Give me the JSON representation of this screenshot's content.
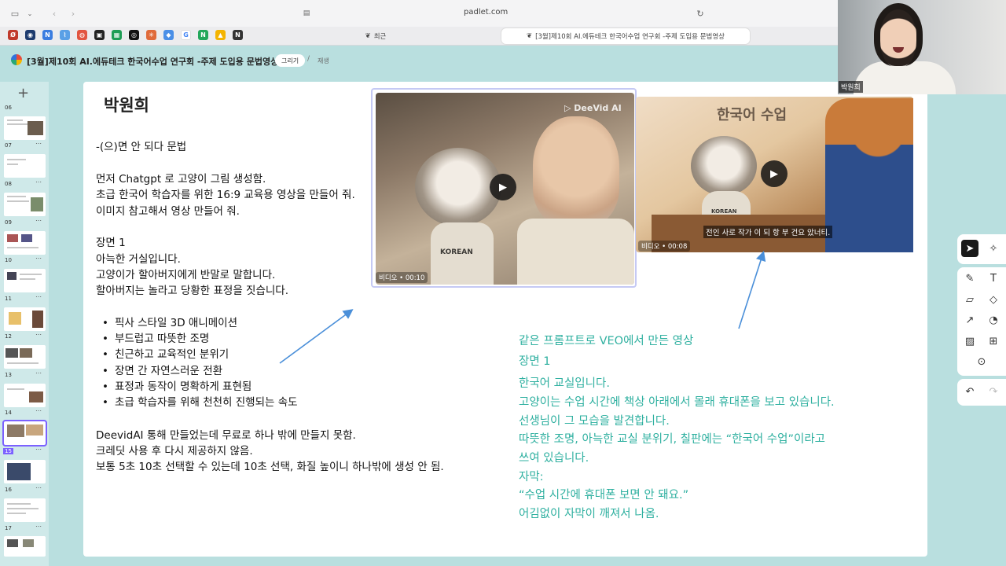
{
  "browser": {
    "url": "padlet.com",
    "tabs": [
      {
        "label": "최근"
      },
      {
        "label": "[3월]제10회 AI.에듀테크 한국어수업 연구회 -주제 도입용 문법영상"
      }
    ]
  },
  "header": {
    "title": "[3월]제10회 AI.에듀테크 한국어수업 연구회 -주제 도입용 문법영상",
    "draw_label": "그리기",
    "play_label": "재생"
  },
  "sidebar": {
    "add_label": "+",
    "slides": [
      {
        "num": "07"
      },
      {
        "num": "08"
      },
      {
        "num": "09"
      },
      {
        "num": "10"
      },
      {
        "num": "11"
      },
      {
        "num": "12"
      },
      {
        "num": "13"
      },
      {
        "num": "14"
      },
      {
        "num": "15"
      },
      {
        "num": "16"
      },
      {
        "num": "17"
      }
    ],
    "partial_top": "06"
  },
  "slide": {
    "author": "박원희",
    "grammar": "-(으)면 안 되다 문법",
    "lines1": [
      "먼저 Chatgpt 로 고양이 그림 생성함.",
      "초급 한국어 학습자를 위한 16:9 교육용 영상을 만들어 줘.",
      "이미지 참고해서 영상 만들어 줘."
    ],
    "scene_title": "장면 1",
    "scene_lines": [
      "아늑한 거실입니다.",
      "고양이가 할아버지에게 반말로 말합니다.",
      "할아버지는 놀라고 당황한 표정을 짓습니다."
    ],
    "bullets": [
      "픽사 스타일 3D 애니메이션",
      "부드럽고 따뜻한 조명",
      "친근하고 교육적인 분위기",
      "장면 간 자연스러운 전환",
      "표정과 동작이 명확하게 표현됨",
      "초급 학습자를 위해 천천히 진행되는 속도"
    ],
    "notes": [
      "DeevidAI 통해 만들었는데 무료로 하나 밖에 만들지 못함.",
      "크레딧 사용 후 다시 제공하지 않음.",
      "보통 5초 10초 선택할 수 있는데 10초 선택, 화질 높이니 하나밖에 생성 안 됨."
    ],
    "video1": {
      "label": "비디오 • 00:10",
      "watermark": "▷ DeeVid AI",
      "tag": "KOREAN"
    },
    "video2": {
      "label": "비디오 • 00:08",
      "board": "한국어 수업",
      "tag": "KOREAN",
      "subtitle": "전인 사로 작가 이 되 항 부 건요 았너티."
    },
    "teal_lines": [
      "같은 프롬프트로 VEO에서 만든 영상",
      "장면 1",
      "한국어 교실입니다.",
      "고양이는 수업 시간에 책상 아래에서 몰래 휴대폰을 보고 있습니다.",
      "선생님이 그 모습을 발견합니다.",
      "따뜻한 조명, 아늑한 교실 분위기, 칠판에는 “한국어 수업”이라고",
      "쓰여 있습니다.",
      "자막:",
      "“수업 시간에 휴대폰 보면 안 돼요.”",
      "어김없이 자막이 깨져서 나옴."
    ]
  },
  "webcam": {
    "name": "박원희"
  },
  "colors": {
    "teal_text": "#2fb0a0",
    "background": "#b9dfdf",
    "selection": "#7b61ff"
  }
}
